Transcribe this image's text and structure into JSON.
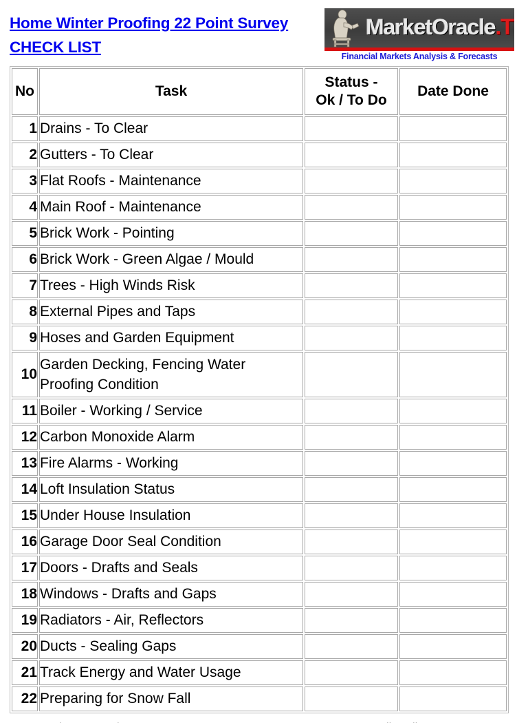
{
  "header": {
    "title_line1": "Home Winter Proofing 22 Point Survey",
    "title_line2": "CHECK LIST",
    "title_color": "#0000ee"
  },
  "logo": {
    "icon_name": "oracle-statue-icon",
    "wordmark_main": "MarketOracle",
    "wordmark_suffix": ".TV",
    "tagline": "Financial Markets Analysis & Forecasts",
    "plate_color": "#4a4a4a",
    "accent_color": "#d81111",
    "tagline_color": "#1a1ad6"
  },
  "table": {
    "columns": [
      {
        "key": "no",
        "label": "No"
      },
      {
        "key": "task",
        "label": "Task"
      },
      {
        "key": "status",
        "label": "Status -\nOk / To Do",
        "label_line1": "Status -",
        "label_line2": "Ok / To Do"
      },
      {
        "key": "date",
        "label": "Date Done"
      }
    ],
    "rows": [
      {
        "no": "1",
        "task": "Drains - To Clear",
        "status": "",
        "date": ""
      },
      {
        "no": "2",
        "task": "Gutters - To Clear",
        "status": "",
        "date": ""
      },
      {
        "no": "3",
        "task": "Flat Roofs - Maintenance",
        "status": "",
        "date": ""
      },
      {
        "no": "4",
        "task": "Main Roof - Maintenance",
        "status": "",
        "date": ""
      },
      {
        "no": "5",
        "task": "Brick Work - Pointing",
        "status": "",
        "date": ""
      },
      {
        "no": "6",
        "task": "Brick Work - Green Algae / Mould",
        "status": "",
        "date": ""
      },
      {
        "no": "7",
        "task": "Trees - High Winds Risk",
        "status": "",
        "date": ""
      },
      {
        "no": "8",
        "task": "External Pipes and Taps",
        "status": "",
        "date": ""
      },
      {
        "no": "9",
        "task": "Hoses and Garden Equipment",
        "status": "",
        "date": ""
      },
      {
        "no": "10",
        "task": "Garden Decking, Fencing Water Proofing Condition",
        "status": "",
        "date": "",
        "tall": true
      },
      {
        "no": "11",
        "task": "Boiler - Working / Service",
        "status": "",
        "date": ""
      },
      {
        "no": "12",
        "task": "Carbon Monoxide Alarm",
        "status": "",
        "date": ""
      },
      {
        "no": "13",
        "task": "Fire Alarms - Working",
        "status": "",
        "date": ""
      },
      {
        "no": "14",
        "task": "Loft Insulation Status",
        "status": "",
        "date": ""
      },
      {
        "no": "15",
        "task": "Under House Insulation",
        "status": "",
        "date": ""
      },
      {
        "no": "16",
        "task": "Garage Door Seal Condition",
        "status": "",
        "date": ""
      },
      {
        "no": "17",
        "task": "Doors - Drafts and Seals",
        "status": "",
        "date": ""
      },
      {
        "no": "18",
        "task": "Windows - Drafts and Gaps",
        "status": "",
        "date": ""
      },
      {
        "no": "19",
        "task": "Radiators - Air, Reflectors",
        "status": "",
        "date": ""
      },
      {
        "no": "20",
        "task": "Ducts - Sealing Gaps",
        "status": "",
        "date": ""
      },
      {
        "no": "21",
        "task": "Track Energy and Water Usage",
        "status": "",
        "date": ""
      },
      {
        "no": "22",
        "task": "Preparing for Snow Fall",
        "status": "",
        "date": ""
      }
    ]
  }
}
